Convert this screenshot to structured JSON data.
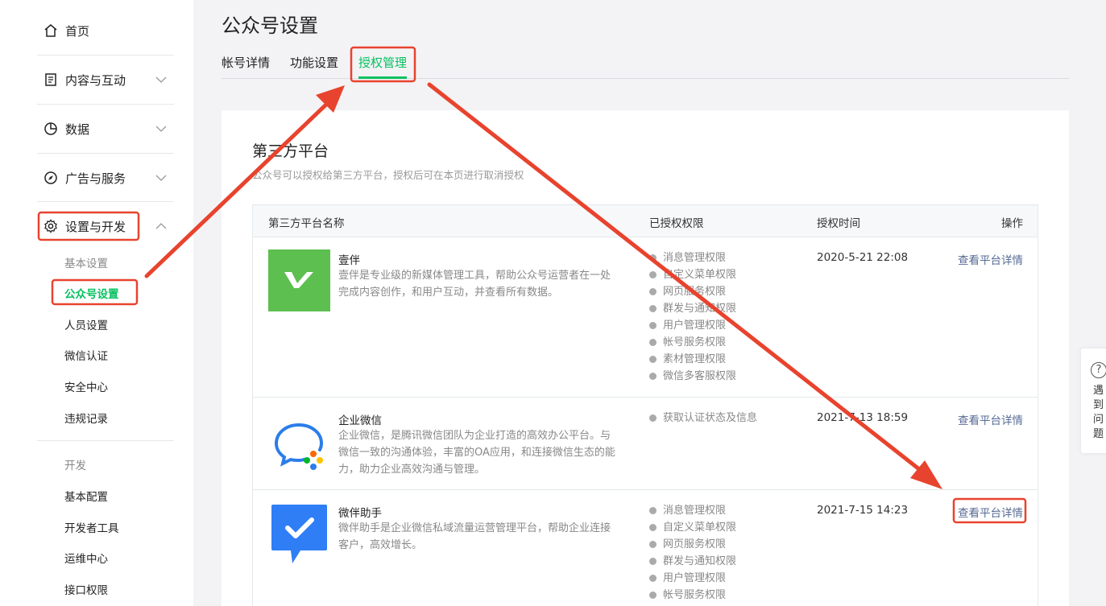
{
  "sidebar": {
    "home": "首页",
    "content": "内容与互动",
    "data": "数据",
    "ads": "广告与服务",
    "settings": "设置与开发",
    "settings_sub": {
      "basic_header": "基本设置",
      "account_settings": "公众号设置",
      "staff": "人员设置",
      "wechat_verify": "微信认证",
      "security": "安全中心",
      "violations": "违规记录",
      "dev_header": "开发",
      "basic_config": "基本配置",
      "dev_tools": "开发者工具",
      "ops_center": "运维中心",
      "api_perms": "接口权限"
    }
  },
  "main": {
    "title": "公众号设置",
    "tabs": [
      "帐号详情",
      "功能设置",
      "授权管理"
    ],
    "active_tab": "授权管理",
    "section_title": "第三方平台",
    "section_desc": "公众号可以授权给第三方平台，授权后可在本页进行取消授权",
    "table": {
      "headers": [
        "第三方平台名称",
        "已授权权限",
        "授权时间",
        "操作"
      ],
      "rows": [
        {
          "name": "壹伴",
          "desc": "壹伴是专业级的新媒体管理工具，帮助公众号运营者在一处完成内容创作，和用户互动，并查看所有数据。",
          "perms": [
            "消息管理权限",
            "自定义菜单权限",
            "网页服务权限",
            "群发与通知权限",
            "用户管理权限",
            "帐号服务权限",
            "素材管理权限",
            "微信多客服权限"
          ],
          "time": "2020-5-21 22:08",
          "action": "查看平台详情"
        },
        {
          "name": "企业微信",
          "desc": "企业微信，是腾讯微信团队为企业打造的高效办公平台。与微信一致的沟通体验，丰富的OA应用，和连接微信生态的能力，助力企业高效沟通与管理。",
          "perms": [
            "获取认证状态及信息"
          ],
          "time": "2021-7-13 18:59",
          "action": "查看平台详情"
        },
        {
          "name": "微伴助手",
          "desc": "微伴助手是企业微信私域流量运营管理平台，帮助企业连接客户，高效增长。",
          "perms": [
            "消息管理权限",
            "自定义菜单权限",
            "网页服务权限",
            "群发与通知权限",
            "用户管理权限",
            "帐号服务权限"
          ],
          "time": "2021-7-15 14:23",
          "action": "查看平台详情"
        }
      ]
    }
  },
  "help": {
    "text": "遇到问题"
  },
  "colors": {
    "accent": "#07c160",
    "link": "#576b95",
    "annotation": "#e8432e"
  }
}
